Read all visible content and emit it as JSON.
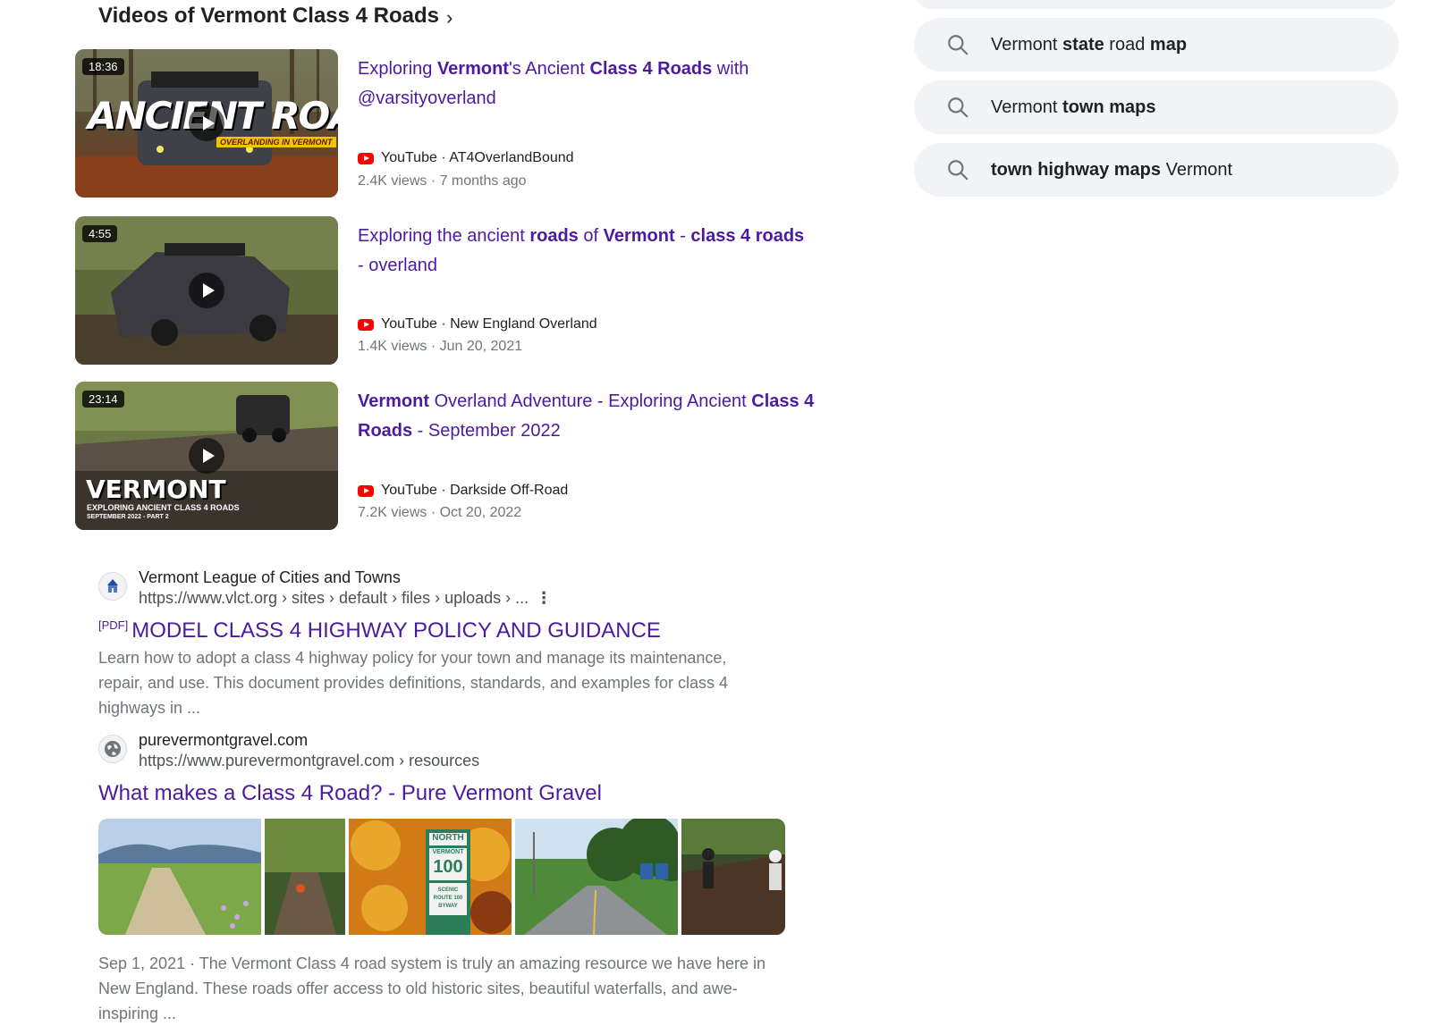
{
  "videos_section": {
    "heading": "Videos of Vermont Class 4 Roads",
    "videos": [
      {
        "duration": "18:36",
        "thumb_text": "ANCIENT ROADS",
        "thumb_subtext": "OVERLANDING IN VERMONT",
        "title_parts": [
          {
            "text": "Exploring ",
            "bold": false
          },
          {
            "text": "Vermont",
            "bold": true
          },
          {
            "text": "'s Ancient ",
            "bold": false
          },
          {
            "text": "Class 4 Roads",
            "bold": true
          },
          {
            "text": " with @varsityoverland",
            "bold": false
          }
        ],
        "source": "YouTube · AT4OverlandBound",
        "meta": "2.4K views · 7 months ago"
      },
      {
        "duration": "4:55",
        "title_parts": [
          {
            "text": "Exploring the ancient ",
            "bold": false
          },
          {
            "text": "roads",
            "bold": true
          },
          {
            "text": " of ",
            "bold": false
          },
          {
            "text": "Vermont",
            "bold": true
          },
          {
            "text": " - ",
            "bold": false
          },
          {
            "text": "class 4 roads",
            "bold": true
          },
          {
            "text": " - overland",
            "bold": false
          }
        ],
        "source": "YouTube · New England Overland",
        "meta": "1.4K views · Jun 20, 2021"
      },
      {
        "duration": "23:14",
        "thumb_text": "VERMONT",
        "thumb_subtext": "EXPLORING ANCIENT CLASS 4 ROADS",
        "thumb_subtext2": "SEPTEMBER 2022 - PART 2",
        "title_parts": [
          {
            "text": "Vermont",
            "bold": true
          },
          {
            "text": " Overland Adventure - Exploring Ancient ",
            "bold": false
          },
          {
            "text": "Class 4 Roads",
            "bold": true
          },
          {
            "text": " - September 2022",
            "bold": false
          }
        ],
        "source": "YouTube · Darkside Off-Road",
        "meta": "7.2K views · Oct 20, 2022"
      }
    ]
  },
  "results": [
    {
      "site_name": "Vermont League of Cities and Towns",
      "url": "https://www.vlct.org › sites › default › files › uploads › ...",
      "pdf_tag": "[PDF]",
      "title": "MODEL CLASS 4 HIGHWAY POLICY AND GUIDANCE",
      "snippet": "Learn how to adopt a class 4 highway policy for your town and manage its maintenance, repair, and use. This document provides definitions, standards, and examples for class 4 highways in ...",
      "icon": "vlct-logo-icon"
    },
    {
      "site_name": "purevermontgravel.com",
      "url": "https://www.purevermontgravel.com › resources",
      "title": "What makes a Class 4 Road? - Pure Vermont Gravel",
      "date": "Sep 1, 2021 · ",
      "snippet": "The Vermont Class 4 road system is truly an amazing resource we have here in New England. These roads offer access to old historic sites, beautiful waterfalls, and awe-inspiring ...",
      "icon": "globe-icon",
      "sign_text": {
        "north": "NORTH",
        "vermont": "VERMONT",
        "number": "100",
        "scenic": "SCENIC ROUTE 100 BYWAY"
      }
    }
  ],
  "related_searches": [
    {
      "parts": [
        {
          "text": "Vermont ",
          "bold": false
        },
        {
          "text": "state",
          "bold": true
        },
        {
          "text": " road ",
          "bold": false
        },
        {
          "text": "map",
          "bold": true
        }
      ]
    },
    {
      "parts": [
        {
          "text": "Vermont ",
          "bold": false
        },
        {
          "text": "town maps",
          "bold": true
        }
      ]
    },
    {
      "parts": [
        {
          "text": "town highway maps",
          "bold": true
        },
        {
          "text": " Vermont",
          "bold": false
        }
      ]
    }
  ],
  "colors": {
    "link_visited": "#4c1aa1",
    "pill_bg": "#f1f3f4",
    "youtube_red": "#ff0000",
    "meta_gray": "#70757a"
  }
}
